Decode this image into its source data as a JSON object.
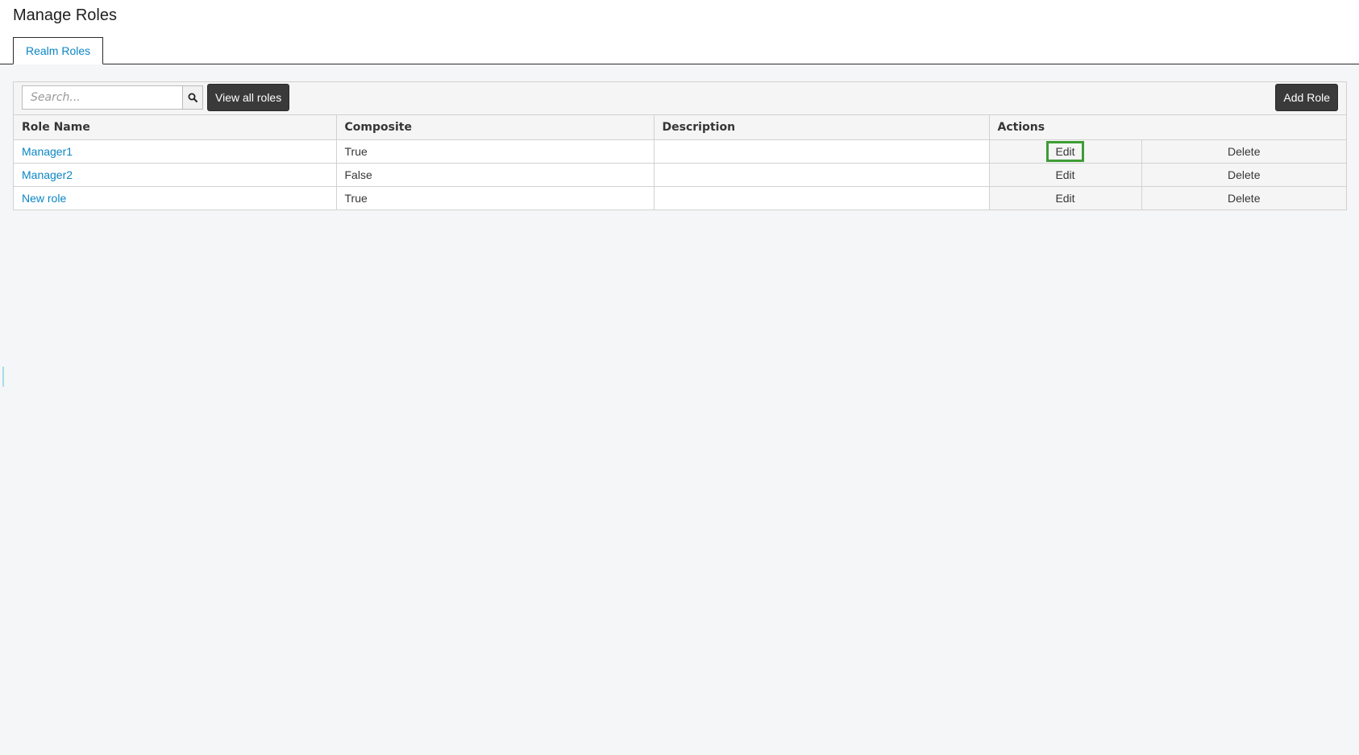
{
  "header": {
    "title": "Manage Roles",
    "tab_label": "Realm Roles"
  },
  "toolbar": {
    "search_placeholder": "Search...",
    "search_value": "",
    "search_icon": "search-icon",
    "view_all_label": "View all roles",
    "add_role_label": "Add Role"
  },
  "table": {
    "columns": [
      "Role Name",
      "Composite",
      "Description",
      "Actions"
    ],
    "rows": [
      {
        "name": "Manager1",
        "composite": "True",
        "description": "",
        "edit": "Edit",
        "delete": "Delete"
      },
      {
        "name": "Manager2",
        "composite": "False",
        "description": "",
        "edit": "Edit",
        "delete": "Delete"
      },
      {
        "name": "New role",
        "composite": "True",
        "description": "",
        "edit": "Edit",
        "delete": "Delete"
      }
    ]
  },
  "colors": {
    "link": "#0a86c4",
    "dark_button": "#3a3a3a",
    "focus_ring": "#3f9c35",
    "background": "#f5f6f7"
  }
}
